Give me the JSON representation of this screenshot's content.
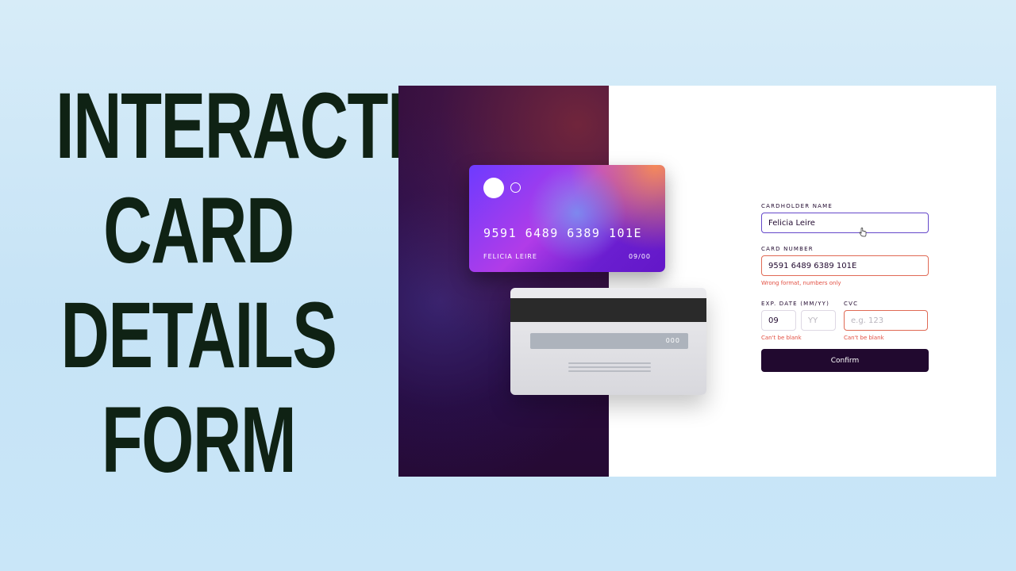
{
  "headline": {
    "line1": "INTERACTIVE",
    "line2": "CARD",
    "line3": "DETAILS",
    "line4": "FORM"
  },
  "card_front": {
    "number": "9591 6489 6389 101E",
    "name": "FELICIA LEIRE",
    "expiry": "09/00"
  },
  "card_back": {
    "cvc": "000"
  },
  "form": {
    "cardholder_label": "CARDHOLDER NAME",
    "cardholder_value": "Felicia Leire",
    "number_label": "CARD NUMBER",
    "number_value": "9591 6489 6389 101E",
    "number_error": "Wrong format, numbers only",
    "exp_label": "EXP. DATE (MM/YY)",
    "month_value": "09",
    "year_placeholder": "YY",
    "exp_error": "Can't be blank",
    "cvc_label": "CVC",
    "cvc_placeholder": "e.g. 123",
    "cvc_error": "Can't be blank",
    "confirm_label": "Confirm"
  },
  "colors": {
    "headline": "#0f2214",
    "dark_violet": "#21092f",
    "error": "#e24f42",
    "focus": "#6548ca"
  }
}
